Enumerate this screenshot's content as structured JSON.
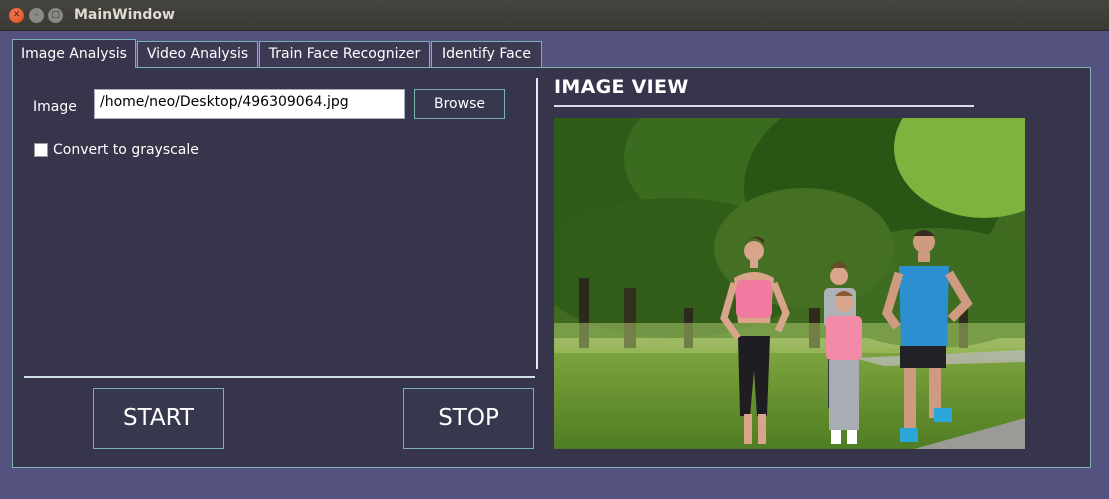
{
  "window": {
    "title": "MainWindow",
    "buttons": [
      "close",
      "minimize",
      "maximize"
    ]
  },
  "tabs": [
    {
      "label": "Image Analysis",
      "active": true
    },
    {
      "label": "Video Analysis",
      "active": false
    },
    {
      "label": "Train Face Recognizer",
      "active": false
    },
    {
      "label": "Identify Face",
      "active": false
    }
  ],
  "image_analysis": {
    "image_label": "Image",
    "image_path": "/home/neo/Desktop/496309064.jpg",
    "browse_label": "Browse",
    "grayscale_label": "Convert to grayscale",
    "grayscale_checked": false,
    "start_label": "START",
    "stop_label": "STOP"
  },
  "image_view": {
    "title": "IMAGE VIEW",
    "image_subject": "photo of family jogging in park"
  },
  "colors": {
    "window_bg": "#555280",
    "panel_bg": "#36354b",
    "accent_border": "#7ab1b3",
    "close_button": "#df4a16"
  }
}
